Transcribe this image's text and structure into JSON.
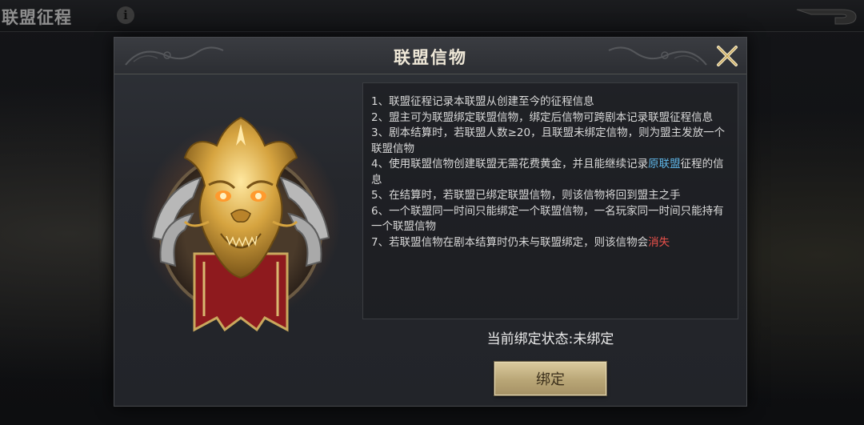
{
  "top_bar": {
    "title": "联盟征程",
    "info_icon": "info-icon",
    "back_icon": "back-arrow-icon"
  },
  "dialog": {
    "title": "联盟信物",
    "close_icon": "close-icon",
    "emblem": "golden-dragon-emblem",
    "rules": [
      {
        "text": "1、联盟征程记录本联盟从创建至今的征程信息"
      },
      {
        "text": "2、盟主可为联盟绑定联盟信物，绑定后信物可跨剧本记录联盟征程信息"
      },
      {
        "text": "3、剧本结算时，若联盟人数≥20，且联盟未绑定信物，则为盟主发放一个联盟信物"
      },
      {
        "text_before": "4、使用联盟信物创建联盟无需花费黄金，并且能继续记录",
        "highlight": "原联盟",
        "text_after": "征程的信息",
        "highlight_color": "#5fb6e8"
      },
      {
        "text": "5、在结算时，若联盟已绑定联盟信物，则该信物将回到盟主之手"
      },
      {
        "text": "6、一个联盟同一时间只能绑定一个联盟信物，一名玩家同一时间只能持有一个联盟信物"
      },
      {
        "text_before": "7、若联盟信物在剧本结算时仍未与联盟绑定，则该信物会",
        "highlight": "消失",
        "text_after": "",
        "highlight_color": "#e8504a"
      }
    ],
    "status_label": "当前绑定状态:未绑定",
    "bind_button_label": "绑定"
  },
  "colors": {
    "accent_gold": "#b9a676",
    "link_blue": "#5fb6e8",
    "warning_red": "#e8504a"
  }
}
